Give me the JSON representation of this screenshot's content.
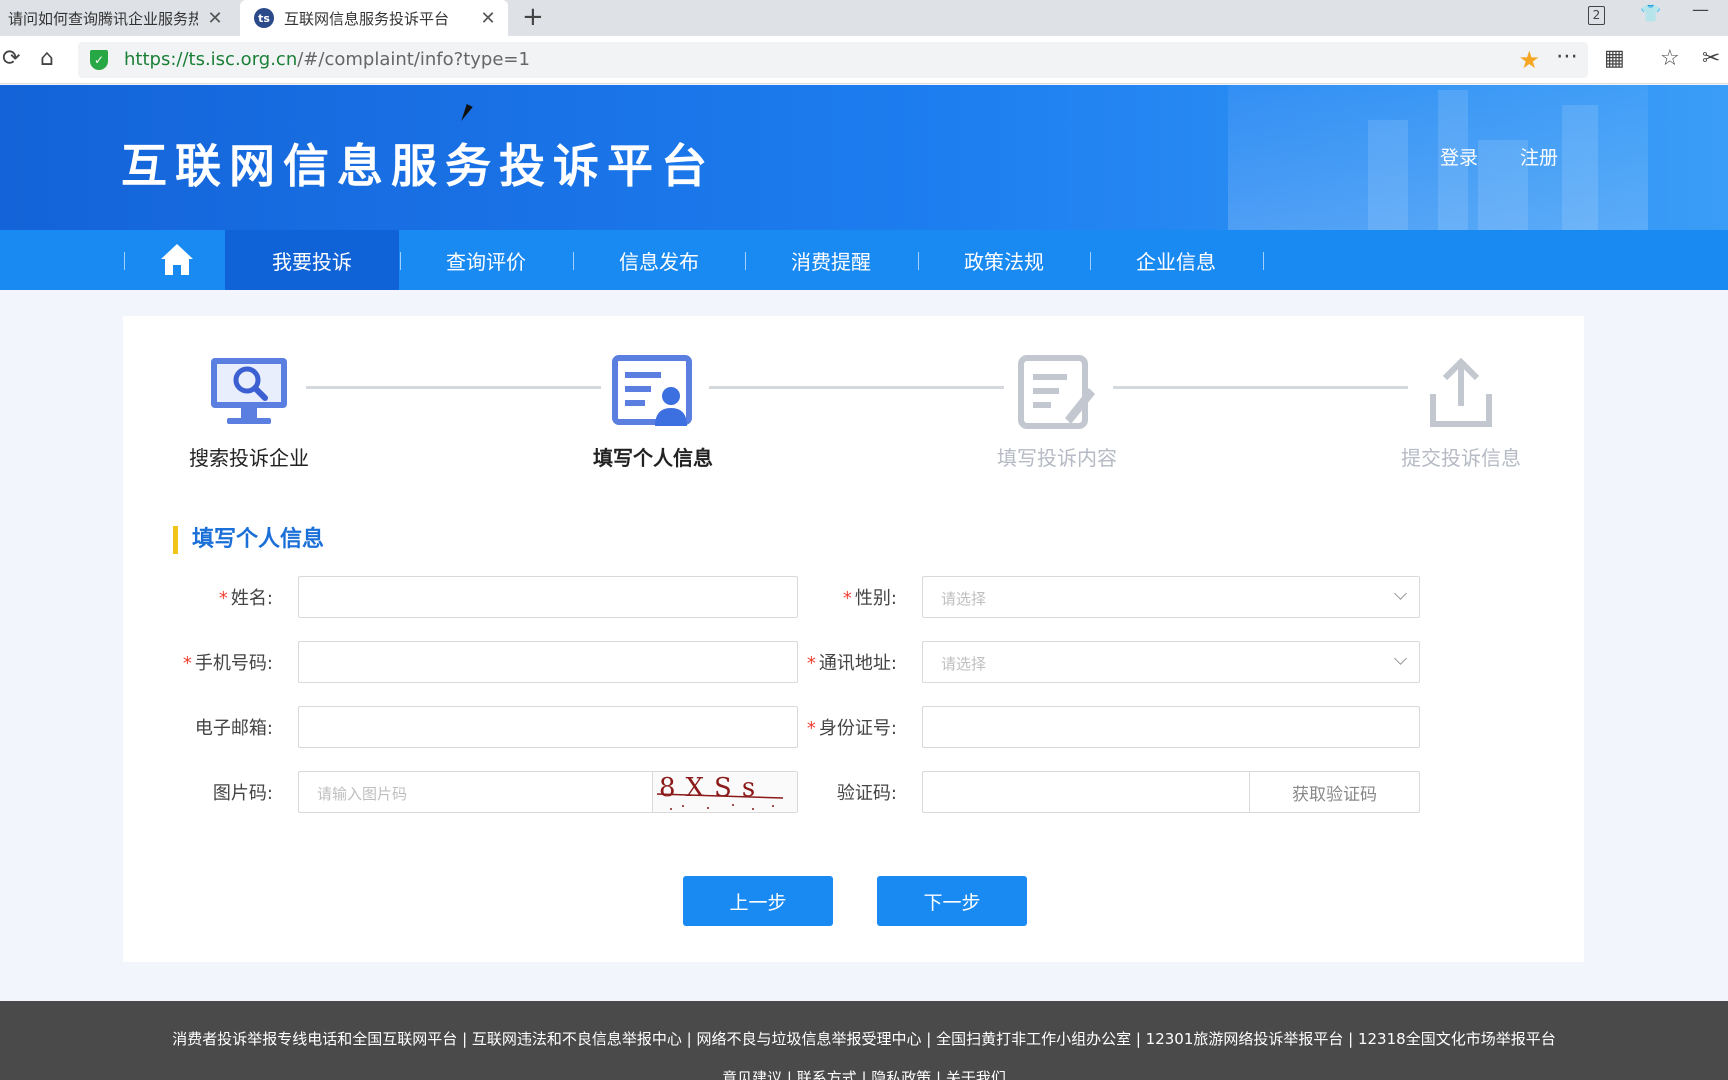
{
  "browser": {
    "tabs": [
      {
        "title": "请问如何查询腾讯企业服务热",
        "close": "✕"
      },
      {
        "title": "互联网信息服务投诉平台",
        "favicon": "ts",
        "close": "✕"
      }
    ],
    "new_tab": "+",
    "tab_count": "2",
    "url_host": "https://ts.isc.org.cn",
    "url_path": "/#/complaint/info?type=1"
  },
  "header": {
    "site_title": "互联网信息服务投诉平台",
    "login": "登录",
    "register": "注册"
  },
  "nav": {
    "items": [
      "我要投诉",
      "查询评价",
      "信息发布",
      "消费提醒",
      "政策法规",
      "企业信息"
    ],
    "active": "我要投诉"
  },
  "steps": [
    {
      "label": "搜索投诉企业",
      "icon": "search-monitor-icon",
      "state": "done"
    },
    {
      "label": "填写个人信息",
      "icon": "id-card-icon",
      "state": "active"
    },
    {
      "label": "填写投诉内容",
      "icon": "edit-document-icon",
      "state": "todo"
    },
    {
      "label": "提交投诉信息",
      "icon": "upload-icon",
      "state": "todo"
    }
  ],
  "form": {
    "section_title": "填写个人信息",
    "name_label": "姓名:",
    "gender_label": "性别:",
    "gender_placeholder": "请选择",
    "phone_label": "手机号码:",
    "address_label": "通讯地址:",
    "address_placeholder": "请选择",
    "email_label": "电子邮箱:",
    "idcard_label": "身份证号:",
    "captcha_label": "图片码:",
    "captcha_placeholder": "请输入图片码",
    "captcha_text": "8XSs",
    "sms_label": "验证码:",
    "get_code": "获取验证码",
    "required_mark": "*"
  },
  "buttons": {
    "prev": "上一步",
    "next": "下一步"
  },
  "footer": {
    "links": "消费者投诉举报专线电话和全国互联网平台 | 互联网违法和不良信息举报中心 | 网络不良与垃圾信息举报受理中心 | 全国扫黄打非工作小组办公室 | 12301旅游网络投诉举报平台 | 12318全国文化市场举报平台",
    "links2": "意见建议 | 联系方式 | 隐私政策 | 关于我们"
  },
  "colors": {
    "primary": "#1a8af3",
    "nav_active": "#0f63d6",
    "required": "#f04134",
    "section_accent": "#f0c419"
  }
}
